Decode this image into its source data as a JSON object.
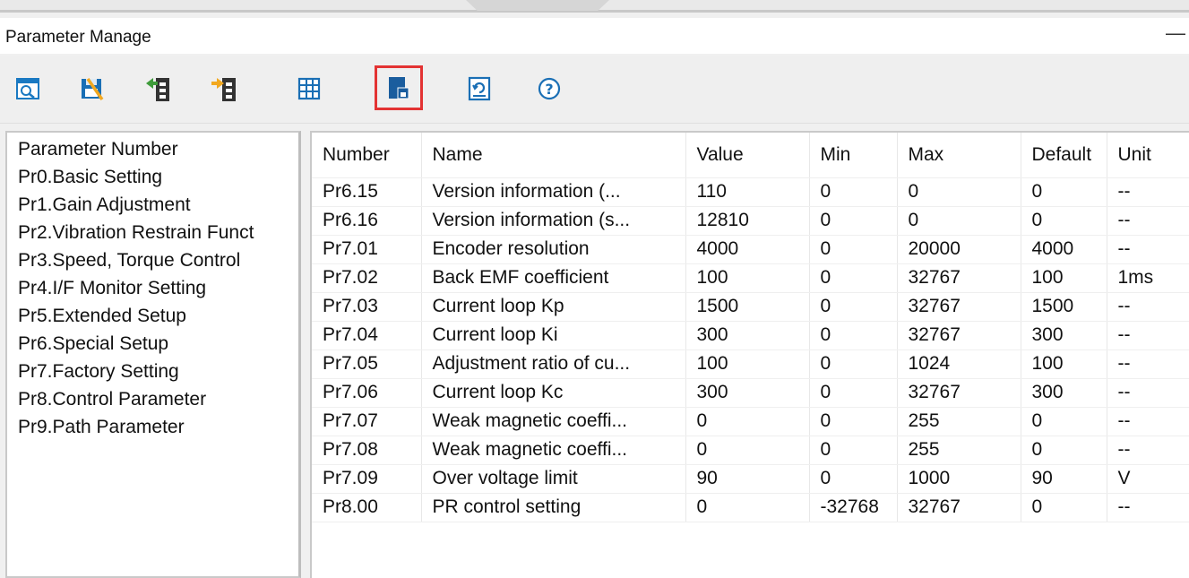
{
  "window": {
    "title": "Parameter Manage",
    "minimize": "—"
  },
  "toolbar": {
    "tools": [
      {
        "name": "open-file-icon"
      },
      {
        "name": "save-file-icon"
      },
      {
        "name": "upload-to-drive-icon"
      },
      {
        "name": "download-from-drive-icon"
      },
      {
        "name": "compare-table-icon"
      },
      {
        "name": "save-to-eeprom-icon",
        "selected": true
      },
      {
        "name": "restore-default-icon"
      },
      {
        "name": "help-icon"
      }
    ],
    "accent_selected": "#e33333"
  },
  "tree": {
    "items": [
      "Parameter Number",
      "Pr0.Basic Setting",
      "Pr1.Gain Adjustment",
      "Pr2.Vibration Restrain Funct",
      "Pr3.Speed, Torque Control",
      "Pr4.I/F Monitor Setting",
      "Pr5.Extended Setup",
      "Pr6.Special Setup",
      "Pr7.Factory Setting",
      "Pr8.Control Parameter",
      "Pr9.Path Parameter"
    ]
  },
  "table": {
    "columns": [
      "Number",
      "Name",
      "Value",
      "Min",
      "Max",
      "Default",
      "Unit"
    ],
    "rows": [
      [
        "Pr6.15",
        "Version information (...",
        "110",
        "0",
        "0",
        "0",
        "--"
      ],
      [
        "Pr6.16",
        "Version information (s...",
        "12810",
        "0",
        "0",
        "0",
        "--"
      ],
      [
        "Pr7.01",
        "Encoder resolution",
        "4000",
        "0",
        "20000",
        "4000",
        "--"
      ],
      [
        "Pr7.02",
        "Back EMF coefficient",
        "100",
        "0",
        "32767",
        "100",
        "1ms"
      ],
      [
        "Pr7.03",
        "Current loop Kp",
        "1500",
        "0",
        "32767",
        "1500",
        "--"
      ],
      [
        "Pr7.04",
        "Current loop Ki",
        "300",
        "0",
        "32767",
        "300",
        "--"
      ],
      [
        "Pr7.05",
        "Adjustment ratio of cu...",
        "100",
        "0",
        "1024",
        "100",
        "--"
      ],
      [
        "Pr7.06",
        "Current loop Kc",
        "300",
        "0",
        "32767",
        "300",
        "--"
      ],
      [
        "Pr7.07",
        "Weak magnetic coeffi...",
        "0",
        "0",
        "255",
        "0",
        "--"
      ],
      [
        "Pr7.08",
        "Weak magnetic coeffi...",
        "0",
        "0",
        "255",
        "0",
        "--"
      ],
      [
        "Pr7.09",
        "Over voltage limit",
        "90",
        "0",
        "1000",
        "90",
        "V"
      ],
      [
        "Pr8.00",
        "PR control setting",
        "0",
        "-32768",
        "32767",
        "0",
        "--"
      ]
    ]
  }
}
